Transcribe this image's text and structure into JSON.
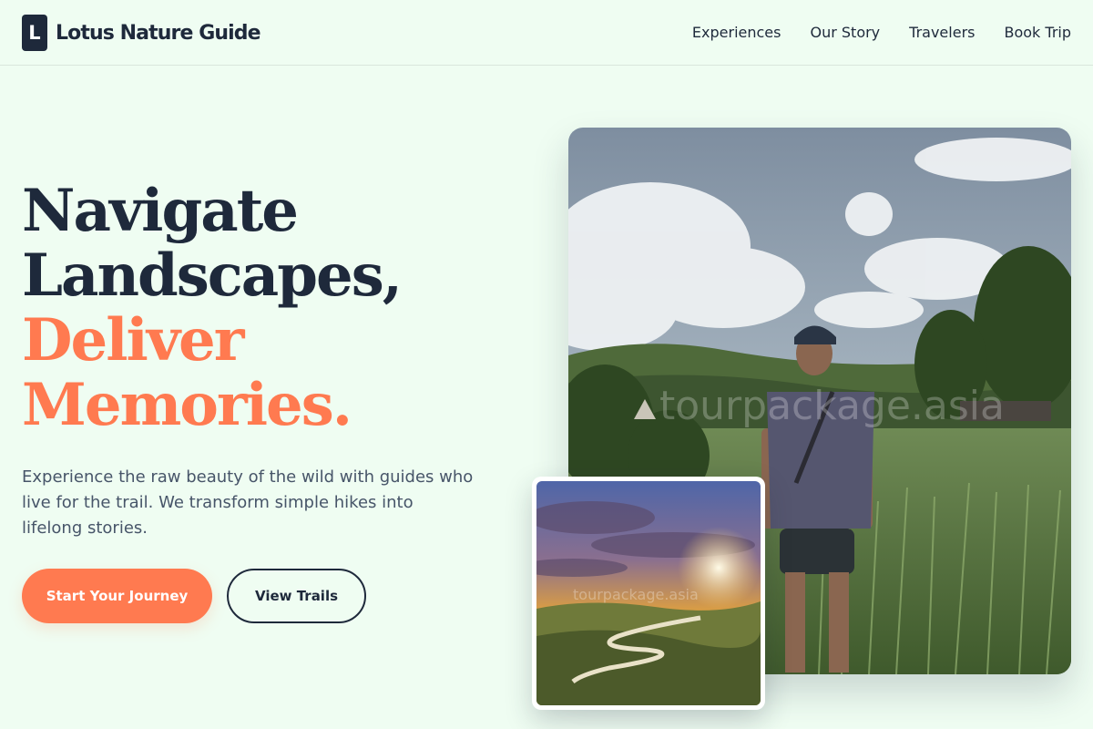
{
  "brand": {
    "logo_letter": "L",
    "name": "Lotus Nature Guide"
  },
  "nav": {
    "items": [
      "Experiences",
      "Our Story",
      "Travelers",
      "Book Trip"
    ]
  },
  "hero": {
    "title_lines": [
      "Navigate",
      "Landscapes,",
      "Deliver",
      "Memories."
    ],
    "description": "Experience the raw beauty of the wild with guides who live for the trail. We transform simple hikes into lifelong stories.",
    "primary_button": "Start Your Journey",
    "secondary_button": "View Trails"
  },
  "images": {
    "main_watermark": "tourpackage.asia",
    "small_watermark": "tourpackage.asia"
  },
  "colors": {
    "brand_dark": "#1e293b",
    "accent": "#ff7a50",
    "background": "#effdf2",
    "body_text": "#475569"
  },
  "icons": {
    "logo": "letter-l-logo-icon"
  }
}
